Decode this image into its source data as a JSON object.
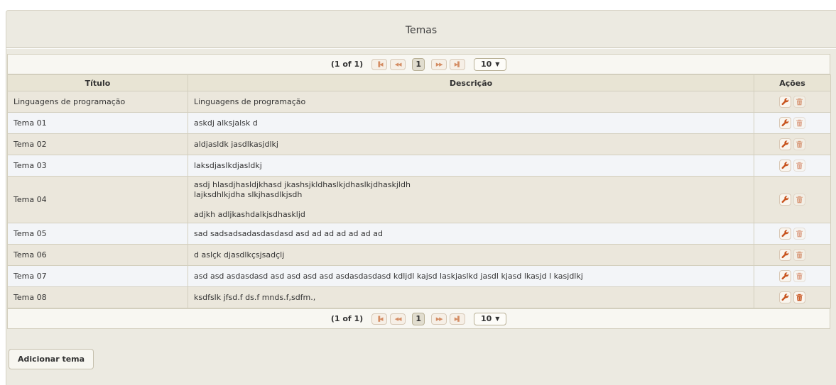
{
  "panel": {
    "title": "Temas"
  },
  "paginator": {
    "current_report": "(1 of 1)",
    "page": "1",
    "rows_per_page": "10"
  },
  "table": {
    "headers": {
      "titulo": "Título",
      "descricao": "Descrição",
      "acoes": "Ações"
    },
    "rows": [
      {
        "titulo": "Linguagens de programação",
        "descricao": [
          "Linguagens de programação"
        ],
        "delete_enabled": false
      },
      {
        "titulo": "Tema 01",
        "descricao": [
          "askdj alksjalsk d"
        ],
        "delete_enabled": false
      },
      {
        "titulo": "Tema 02",
        "descricao": [
          "aldjasldk jasdlkasjdlkj"
        ],
        "delete_enabled": false
      },
      {
        "titulo": "Tema 03",
        "descricao": [
          "laksdjaslkdjasldkj"
        ],
        "delete_enabled": false
      },
      {
        "titulo": "Tema 04",
        "descricao": [
          "asdj hlasdjhasldjkhasd jkashsjkldhaslkjdhaslkjdhaskjldh",
          "lajksdhlkjdha slkjhasdlkjsdh",
          "",
          "adjkh adljkashdalkjsdhaskljd"
        ],
        "delete_enabled": false
      },
      {
        "titulo": "Tema 05",
        "descricao": [
          "sad sadsadsadasdasdasd asd ad ad ad ad ad ad"
        ],
        "delete_enabled": false
      },
      {
        "titulo": "Tema 06",
        "descricao": [
          "d aslçk djasdlkçsjsadçlj"
        ],
        "delete_enabled": false
      },
      {
        "titulo": "Tema 07",
        "descricao": [
          "asd asd asdasdasd asd asd asd asd asdasdasdasd kdljdl kajsd laskjaslkd jasdl kjasd lkasjd l kasjdlkj"
        ],
        "delete_enabled": false
      },
      {
        "titulo": "Tema 08",
        "descricao": [
          "ksdfslk jfsd.f ds.f mnds.f,sdfm.,"
        ],
        "delete_enabled": true
      }
    ]
  },
  "add_button": {
    "label": "Adicionar tema"
  },
  "icons": {
    "edit": "wrench-icon",
    "delete": "trash-icon",
    "first": "first-page-icon",
    "prev": "prev-page-icon",
    "next": "next-page-icon",
    "last": "last-page-icon"
  },
  "colors": {
    "panel_bg": "#eceae1",
    "icon_accent": "#c8541f",
    "row_odd": "#f3f5f8",
    "row_even": "#ebe7dc"
  }
}
